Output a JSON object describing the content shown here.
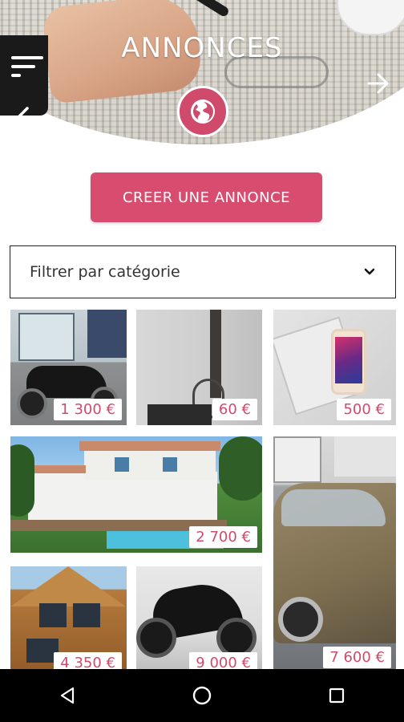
{
  "header": {
    "title": "ANNONCES",
    "icons": [
      "menu-icon",
      "back-arrow-icon",
      "forward-arrow-icon",
      "globe-icon"
    ],
    "accent_color": "#d04a6c"
  },
  "cta": {
    "label": "CREER UNE ANNONCE"
  },
  "filter": {
    "label": "Filtrer par catégorie",
    "icon": "chevron-down-icon"
  },
  "listings": [
    {
      "price": "1 300 €"
    },
    {
      "price": "60 €"
    },
    {
      "price": "500 €"
    },
    {
      "price": "2 700 €"
    },
    {
      "price": "4 350 €"
    },
    {
      "price": "9 000 €"
    },
    {
      "price": "7 600 €"
    }
  ],
  "navbar": {
    "icons": [
      "back-triangle-icon",
      "home-circle-icon",
      "recents-square-icon"
    ]
  }
}
